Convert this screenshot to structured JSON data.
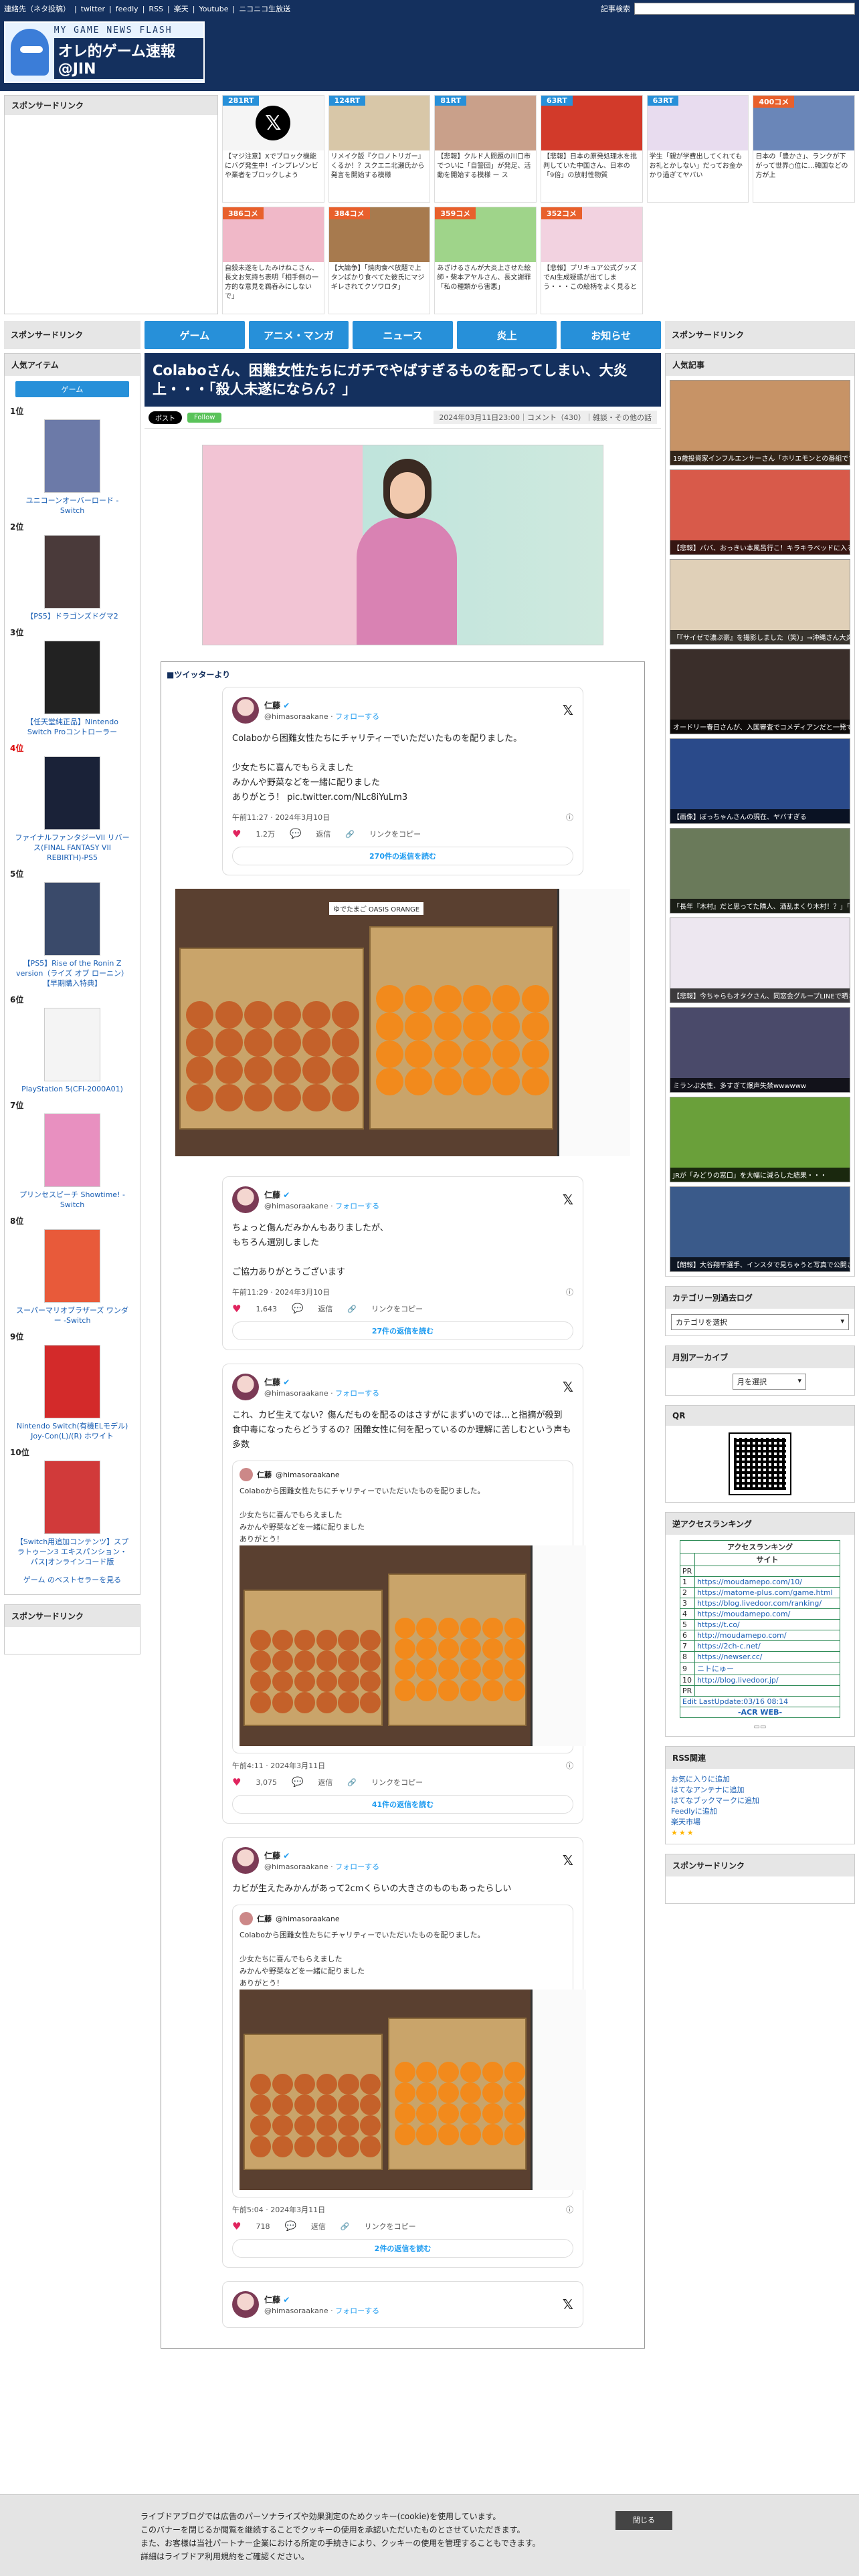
{
  "topbar": {
    "links": [
      "連絡先（ネタ投稿）",
      "twitter",
      "feedly",
      "RSS",
      "楽天",
      "Youtube",
      "ニコニコ生放送"
    ],
    "search_label": "記事検索"
  },
  "header": {
    "logo_sub": "MY GAME NEWS FLASH",
    "logo_title": "オレ的ゲーム速報@JIN",
    "news_left": [
      "",
      "",
      "",
      "",
      ""
    ],
    "news_right": [
      "",
      "",
      "",
      "",
      ""
    ]
  },
  "feature": {
    "sponsor": "スポンサードリンク",
    "cells": [
      {
        "badge": "281RT",
        "color": "#2790d9",
        "caption": "【マジ注意】Xでブロック機能にバグ発生中！インプレゾンビや業者をブロックしよう"
      },
      {
        "badge": "124RT",
        "color": "#2790d9",
        "caption": "リメイク版『クロノトリガー』くるか！？スクエニ北瀬氏から発言を開始する模様"
      },
      {
        "badge": "81RT",
        "color": "#2790d9",
        "caption": "【悲報】クルド人問題の川口市でついに「自警団」が発足、活動を開始する模様 ー ス"
      },
      {
        "badge": "63RT",
        "color": "#2790d9",
        "caption": "【悲報】日本の原発処理水を批判していた中国さん、日本の「9倍」の放射性物質"
      },
      {
        "badge": "63RT",
        "color": "#2790d9",
        "caption": "学生「親が学費出してくれてもお礼とかしない」だってお金かかり過ぎてヤバい"
      },
      {
        "badge": "400コメ",
        "color": "#e8602c",
        "caption": "日本の「豊かさ」、ランクが下がって世界○位に…韓国などの方が上"
      },
      {
        "badge": "386コメ",
        "color": "#e8602c",
        "caption": "自殺未遂をしたみけねこさん、長文お気持ち表明「相手側の一方的な意見を鵜呑みにしないで」"
      },
      {
        "badge": "384コメ",
        "color": "#e8602c",
        "caption": "【大論争】「焼肉食べ放題で上タンばかり食べてた彼氏にマジギレされてクソワロタ」"
      },
      {
        "badge": "359コメ",
        "color": "#e8602c",
        "caption": "あざけるさんが大炎上させた絵師・柴本アヤルさん、長文謝罪「私の種類から害悪」"
      },
      {
        "badge": "352コメ",
        "color": "#e8602c",
        "caption": "【悲報】プリキュア公式グッズでAI生成疑惑が出てしまう・・・この絵柄をよく見ると"
      }
    ]
  },
  "nav": {
    "left_head": "スポンサードリンク",
    "right_head": "スポンサードリンク",
    "tabs": [
      "ゲーム",
      "アニメ・マンガ",
      "ニュース",
      "炎上",
      "お知らせ"
    ]
  },
  "left": {
    "ranking_head": "人気アイテム",
    "ranking_tab": "ゲーム",
    "items": [
      {
        "rank": "1位",
        "title": "ユニコーンオーバーロード -Switch"
      },
      {
        "rank": "2位",
        "title": "【PS5】ドラゴンズドグマ2"
      },
      {
        "rank": "3位",
        "title": "【任天堂純正品】Nintendo Switch Proコントローラー"
      },
      {
        "rank": "4位",
        "title": "ファイナルファンタジーVII リバース(FINAL FANTASY VII REBIRTH)-PS5"
      },
      {
        "rank": "5位",
        "title": "【PS5】Rise of the Ronin Z version（ライズ オブ ローニン）【早期購入特典】"
      },
      {
        "rank": "6位",
        "title": "PlayStation 5(CFI-2000A01)"
      },
      {
        "rank": "7位",
        "title": "プリンセスピーチ Showtime! -Switch"
      },
      {
        "rank": "8位",
        "title": "スーパーマリオブラザーズ ワンダー -Switch"
      },
      {
        "rank": "9位",
        "title": "Nintendo Switch(有機ELモデル) Joy-Con(L)/(R) ホワイト"
      },
      {
        "rank": "10位",
        "title": "【Switch用追加コンテンツ】スプラトゥーン3 エキスパンション・パス|オンラインコード版"
      }
    ],
    "more": "ゲーム のベストセラーを見る",
    "sponsor2": "スポンサードリンク"
  },
  "article": {
    "title": "Colaboさん、困難女性たちにガチでやばすぎるものを配ってしまい、大炎上・・・「殺人未遂にならん？」",
    "x_btn": "ポスト",
    "follow_btn": "Follow",
    "meta": "2024年03月11日23:00｜コメント（430）｜雑談・その他の話"
  },
  "tweets_label": "■ツイッターより",
  "tweets": [
    {
      "name": "仁藤",
      "handle": "@himasoraakane",
      "follow": "フォローする",
      "lines": [
        "Colaboから困難女性たちにチャリティーでいただいたものを配りました。",
        "",
        "少女たちに喜んでもらえました",
        "みかんや野菜などを一緒に配りました",
        "ありがとう！ pic.twitter.com/NLc8iYuLm3"
      ],
      "time": "午前11:27 · 2024年3月10日",
      "likes": "1.2万",
      "replies": "返信",
      "share": "リンクをコピー",
      "more": "270件の返信を読む"
    },
    {
      "name": "仁藤",
      "handle": "@himasoraakane",
      "follow": "フォローする",
      "lines": [
        "ちょっと傷んだみかんもありましたが、",
        "もちろん選別しました",
        "",
        "ご協力ありがとうございます"
      ],
      "time": "午前11:29 · 2024年3月10日",
      "likes": "1,643",
      "replies": "返信",
      "share": "リンクをコピー",
      "more": "27件の返信を読む"
    },
    {
      "name": "仁藤",
      "handle": "@himasoraakane",
      "follow": "フォローする",
      "lines": [
        "これ、カビ生えてない？傷んだものを配るのはさすがにまずいのでは…と指摘が殺到",
        "食中毒になったらどうするの？困難女性に何を配っているのか理解に苦しむという声も多数"
      ],
      "quote_name": "仁藤",
      "quote_handle": "@himasoraakane",
      "quote_lines": [
        "Colaboから困難女性たちにチャリティーでいただいたものを配りました。",
        "",
        "少女たちに喜んでもらえました",
        "みかんや野菜などを一緒に配りました",
        "ありがとう！"
      ],
      "time": "午前4:11 · 2024年3月11日",
      "likes": "3,075",
      "replies": "返信",
      "share": "リンクをコピー",
      "more": "41件の返信を読む"
    },
    {
      "name": "仁藤",
      "handle": "@himasoraakane",
      "follow": "フォローする",
      "lines": [
        "カビが生えたみかんがあって2cmくらいの大きさのものもあったらしい"
      ],
      "quote_name": "仁藤",
      "quote_handle": "@himasoraakane",
      "quote_lines": [
        "Colaboから困難女性たちにチャリティーでいただいたものを配りました。",
        "",
        "少女たちに喜んでもらえました",
        "みかんや野菜などを一緒に配りました",
        "ありがとう！"
      ],
      "time": "午前5:04 · 2024年3月11日",
      "likes": "718",
      "replies": "返信",
      "share": "リンクをコピー",
      "more": "2件の返信を読む"
    },
    {
      "name": "仁藤",
      "handle": "@himasoraakane",
      "follow": "フォローする",
      "lines": [],
      "time": "",
      "likes": "",
      "replies": "",
      "share": "",
      "more": ""
    }
  ],
  "photo_caption": "ゆでたまご OASIS ORANGE",
  "right": {
    "popular_head": "人気記事",
    "popular": [
      "19歳投資家インフルエンサーさん「ホリエモンとの番組でできた一」→借金「人数すげえ！」",
      "【悲報】ババ、おっきい本風呂行こ！キラキラベッドに入ると何が起こる？",
      "「『サイゼで濃ぷ豪』を撮影しました（笑）」→沖縄さん大炎上",
      "オードリー春日さんが、入国審査でコメディアンだと一発で証明したものがコチラwwwwww",
      "【画像】ぼっちゃんさんの現在、ヤバすぎる",
      "「長年『木村』だと思ってた隣人、酒乱まくり木村！？」「木村」だった。普段よく見て",
      "【悲報】今ちゃらもオタクさん、同窓会グループLINEで晒されて家族に怒られる",
      "ミランぶ女性、多すぎて爆声失禁wwwwww",
      "JRが「みどりの窓口」を大幅に減らした結果・・・",
      "【朗報】大谷翔平選手、インスタで見ちゃうと写真で公開されているお嫁さん"
    ],
    "category_head": "カテゴリー別過去ログ",
    "category_select": "カテゴリを選択",
    "monthly_head": "月別アーカイブ",
    "monthly_select": "月を選択",
    "qr_head": "QR",
    "access_head": "逆アクセスランキング",
    "access_title": "アクセスランキング",
    "access_sub": "サイト",
    "access_rows": [
      [
        "PR",
        ""
      ],
      [
        "1",
        "https://moudamepo.com/10/"
      ],
      [
        "2",
        "https://matome-plus.com/game.html"
      ],
      [
        "3",
        "https://blog.livedoor.com/ranking/"
      ],
      [
        "4",
        "https://moudamepo.com/"
      ],
      [
        "5",
        "https://t.co/"
      ],
      [
        "6",
        "http://moudamepo.com/"
      ],
      [
        "7",
        "https://2ch-c.net/"
      ],
      [
        "8",
        "https://newser.cc/"
      ],
      [
        "9",
        "ニトにゅー"
      ],
      [
        "10",
        "http://blog.livedoor.jp/"
      ],
      [
        "PR",
        ""
      ]
    ],
    "access_footer": "Edit LastUpdate:03/16 08:14",
    "access_acr": "-ACR WEB-",
    "rss_head": "RSS関連",
    "rss_links": [
      "お気に入りに追加",
      "はてなアンテナに追加",
      "はてなブックマークに追加",
      "Feedlyに追加",
      "楽天市場"
    ],
    "sponsor3": "スポンサードリンク"
  },
  "cookie": {
    "lines": [
      "ライブドアブログでは広告のパーソナライズや効果測定のためクッキー(cookie)を使用しています。",
      "このバナーを閉じるか閲覧を継続することでクッキーの使用を承認いただいたものとさせていただきます。",
      "また、お客様は当社パートナー企業における所定の手続きにより、クッキーの使用を管理することもできます。",
      "詳細はライブドア利用規約をご確認ください。"
    ],
    "close": "閉じる"
  }
}
